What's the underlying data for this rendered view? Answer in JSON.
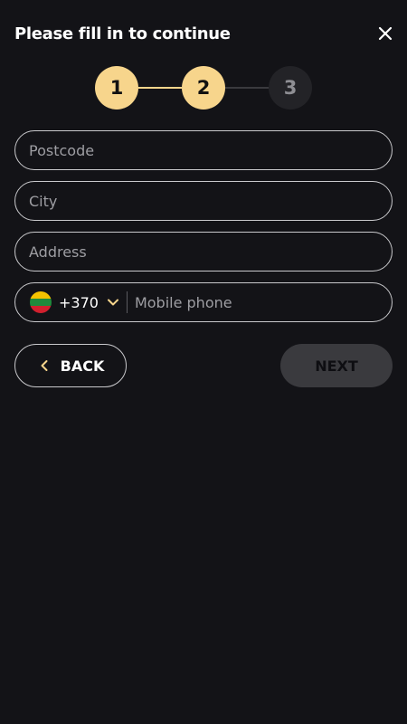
{
  "header": {
    "title": "Please fill in to continue",
    "close_icon": "close-icon"
  },
  "stepper": {
    "steps": [
      {
        "label": "1",
        "state": "completed"
      },
      {
        "label": "2",
        "state": "active"
      },
      {
        "label": "3",
        "state": "inactive"
      }
    ],
    "current_step": 2,
    "colors": {
      "active_fill": "#f7d58c",
      "active_text": "#111111",
      "inactive_fill": "#232327",
      "inactive_text": "#8e8e93",
      "line_done": "#f7d58c",
      "line_pending": "#3a3a3e"
    }
  },
  "form": {
    "postcode": {
      "placeholder": "Postcode",
      "value": ""
    },
    "city": {
      "placeholder": "City",
      "value": ""
    },
    "address": {
      "placeholder": "Address",
      "value": ""
    },
    "phone": {
      "country_flag": "lithuania-flag-icon",
      "dial_code": "+370",
      "placeholder": "Mobile phone",
      "value": ""
    }
  },
  "actions": {
    "back_label": "BACK",
    "next_label": "NEXT",
    "next_disabled": true
  },
  "colors": {
    "background": "#131317",
    "accent": "#f7d58c",
    "field_border": "#c9c9cc",
    "placeholder": "#9e9ea3",
    "next_button_bg": "#3a3a3e"
  }
}
